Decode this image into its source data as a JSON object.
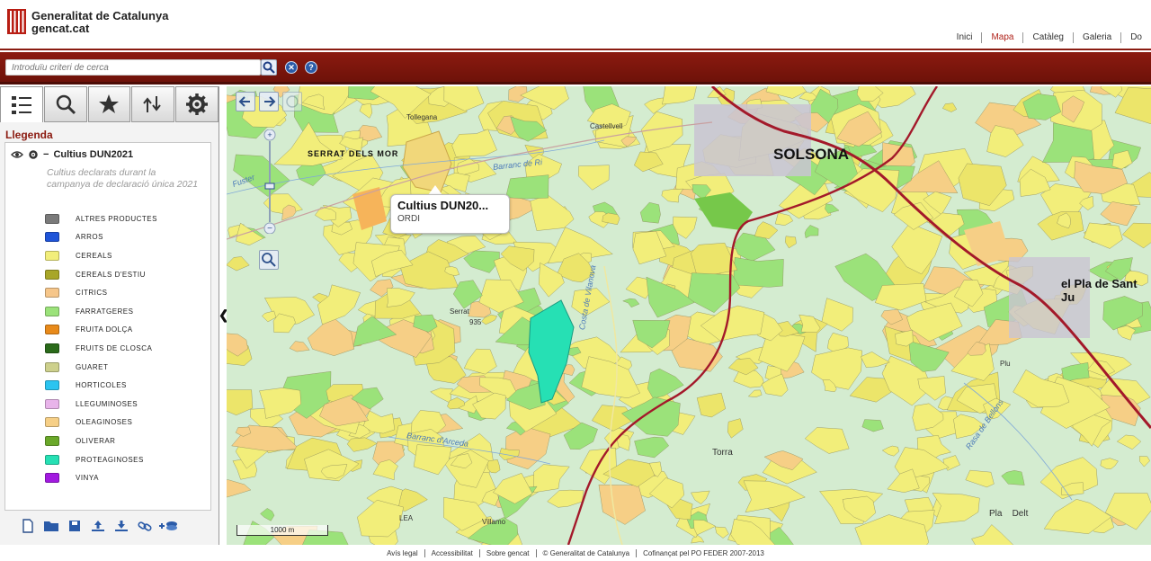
{
  "header": {
    "logo_line1": "Generalitat de Catalunya",
    "logo_line2": "gencat.cat",
    "nav": [
      "Inici",
      "Mapa",
      "Catàleg",
      "Galeria",
      "Do"
    ],
    "active_nav": "Mapa"
  },
  "search": {
    "placeholder": "Introduïu criteri de cerca"
  },
  "panel": {
    "legend_title": "Llegenda",
    "layer_name": "Cultius DUN2021",
    "layer_description": "Cultius declarats durant la campanya de declaració única 2021",
    "items": [
      {
        "label": "ALTRES PRODUCTES",
        "color": "#7a7a7a"
      },
      {
        "label": "ARROS",
        "color": "#1f54d8"
      },
      {
        "label": "CEREALS",
        "color": "#f2ee7a"
      },
      {
        "label": "CEREALS D'ESTIU",
        "color": "#a8a628"
      },
      {
        "label": "CITRICS",
        "color": "#f6c68a"
      },
      {
        "label": "FARRATGERES",
        "color": "#9be27a"
      },
      {
        "label": "FRUITA DOLÇA",
        "color": "#e88a1a"
      },
      {
        "label": "FRUITS DE CLOSCA",
        "color": "#2a6a1a"
      },
      {
        "label": "GUARET",
        "color": "#cdd08c"
      },
      {
        "label": "HORTICOLES",
        "color": "#2bc4f0"
      },
      {
        "label": "LLEGUMINOSES",
        "color": "#e8b4ea"
      },
      {
        "label": "OLEAGINOSES",
        "color": "#f6cf86"
      },
      {
        "label": "OLIVERAR",
        "color": "#6aa82a"
      },
      {
        "label": "PROTEAGINOSES",
        "color": "#26e0b4"
      },
      {
        "label": "VINYA",
        "color": "#a21ae0"
      }
    ]
  },
  "map": {
    "popup_title": "Cultius DUN20...",
    "popup_value": "ORDI",
    "scale_label": "1000 m",
    "places": {
      "solsona": "SOLSONA",
      "pla_sant": "el Pla de Sant Ju",
      "serrat_mort": "SERRAT DELS MOR",
      "torra": "Torra",
      "pla_delt": "Pla    Delt"
    },
    "minor_labels": {
      "castellvell": "Castellvell",
      "serrat": "Serrat",
      "tollegana": "Tollegana",
      "valls": "Villamo",
      "lea": "LEA",
      "plu": "Plu",
      "b935": "935"
    },
    "streams": {
      "barranc_fuster": "Fuster",
      "riera_rib": "Barranc de Ri",
      "barranc_arceda": "Barranc d'Arceda",
      "riu_cardener": "Costa de Vilanova",
      "rasa": "Rasa de Bellons"
    }
  },
  "footer": {
    "links": [
      "Avís legal",
      "Accessibilitat",
      "Sobre gencat",
      "© Generalitat de Catalunya",
      "Cofinançat pel PO FEDER 2007-2013"
    ]
  },
  "colors": {
    "brand_red": "#8b1a10",
    "crop_yellow": "#f2ee7a",
    "base_green": "#cfe8cf",
    "road": "#a3192a"
  }
}
